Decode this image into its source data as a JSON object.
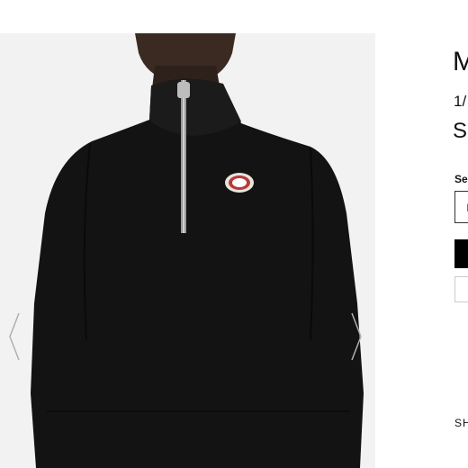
{
  "product": {
    "title": "M",
    "subtitle": "1/",
    "price": "S"
  },
  "size_selector": {
    "label": "Se",
    "value": "I"
  },
  "share": {
    "label": "SH"
  },
  "icons": {
    "gallery_prev": "chevron-left-icon",
    "gallery_next": "chevron-right-icon",
    "logo_patch": "brand-logo-patch"
  },
  "colors": {
    "garment": "#121212",
    "gallery_background": "#f2f2f2",
    "accent_button": "#000000"
  }
}
